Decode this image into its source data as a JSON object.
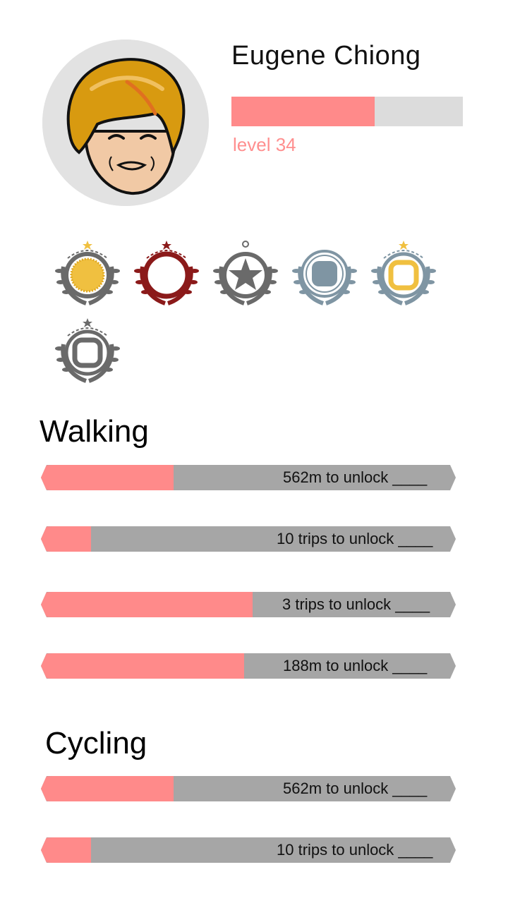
{
  "profile": {
    "name": "Eugene Chiong",
    "level_text": "level 34",
    "level_progress": 0.62
  },
  "badges": [
    {
      "icon": "gold-sun-laurel-badge-icon",
      "color": "#f0c040"
    },
    {
      "icon": "red-ring-laurel-badge-icon",
      "color": "#8b1a1a"
    },
    {
      "icon": "grey-star-laurel-badge-icon",
      "color": "#6a6a6a"
    },
    {
      "icon": "blue-square-laurel-badge-icon",
      "color": "#7f95a3"
    },
    {
      "icon": "gold-square-laurel-badge-icon",
      "color": "#f0c040"
    },
    {
      "icon": "grey-square-laurel-badge-icon",
      "color": "#6a6a6a"
    }
  ],
  "walking": {
    "title": "Walking",
    "bars": [
      {
        "label": "562m to unlock ____",
        "progress": 0.32
      },
      {
        "label": "10 trips to unlock ____",
        "progress": 0.12
      },
      {
        "label": "3 trips to unlock ____",
        "progress": 0.51
      },
      {
        "label": "188m to unlock ____",
        "progress": 0.49
      }
    ]
  },
  "cycling": {
    "title": "Cycling",
    "bars": [
      {
        "label": "562m to unlock ____",
        "progress": 0.32
      },
      {
        "label": "10 trips to unlock ____",
        "progress": 0.12
      }
    ]
  },
  "colors": {
    "accent": "#ff8a8a",
    "track": "#a6a6a6",
    "level_text": "#ff8f8f",
    "xp_track": "#dcdcdc"
  }
}
